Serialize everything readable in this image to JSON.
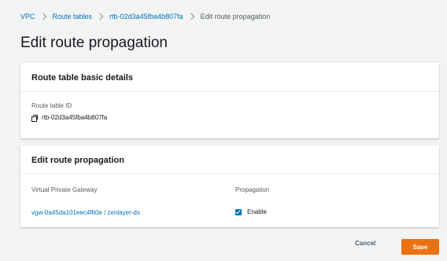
{
  "breadcrumb": {
    "items": [
      "VPC",
      "Route tables",
      "rtb-02d3a45fba4b807fa"
    ],
    "current": "Edit route propagation"
  },
  "page": {
    "title": "Edit route propagation"
  },
  "basic_details": {
    "header": "Route table basic details",
    "id_label": "Route table ID",
    "id_value": "rtb-02d3a45fba4b807fa"
  },
  "propagation": {
    "header": "Edit route propagation",
    "col_gateway": "Virtual Private Gateway",
    "col_propagation": "Propagation",
    "rows": [
      {
        "gateway": "vgw-0a45da101eec4f60e / zenlayer-dx",
        "enable_label": "Enable",
        "enabled": true
      }
    ]
  },
  "actions": {
    "cancel": "Cancel",
    "save": "Save"
  },
  "colors": {
    "accent": "#ec7211",
    "link": "#0073bb"
  }
}
